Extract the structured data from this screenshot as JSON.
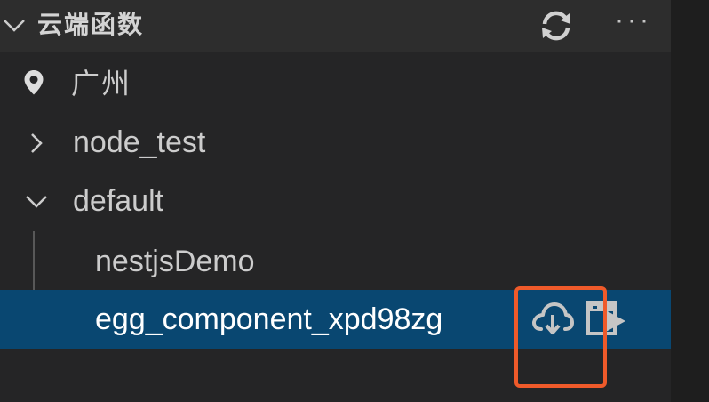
{
  "section": {
    "title": "云端函数",
    "more_label": "···"
  },
  "tree": {
    "region": "广州",
    "items": [
      {
        "label": "node_test",
        "expanded": false
      },
      {
        "label": "default",
        "expanded": true
      }
    ],
    "children": [
      {
        "label": "nestjsDemo",
        "selected": false
      },
      {
        "label": "egg_component_xpd98zg",
        "selected": true
      }
    ]
  },
  "actions": {
    "download_icon": "cloud-download-icon",
    "deploy_icon": "deploy-icon"
  },
  "colors": {
    "panel_bg": "#252526",
    "header_bg": "#2d2d2d",
    "selection_bg": "#094771",
    "highlight_border": "#ef5a2a"
  }
}
